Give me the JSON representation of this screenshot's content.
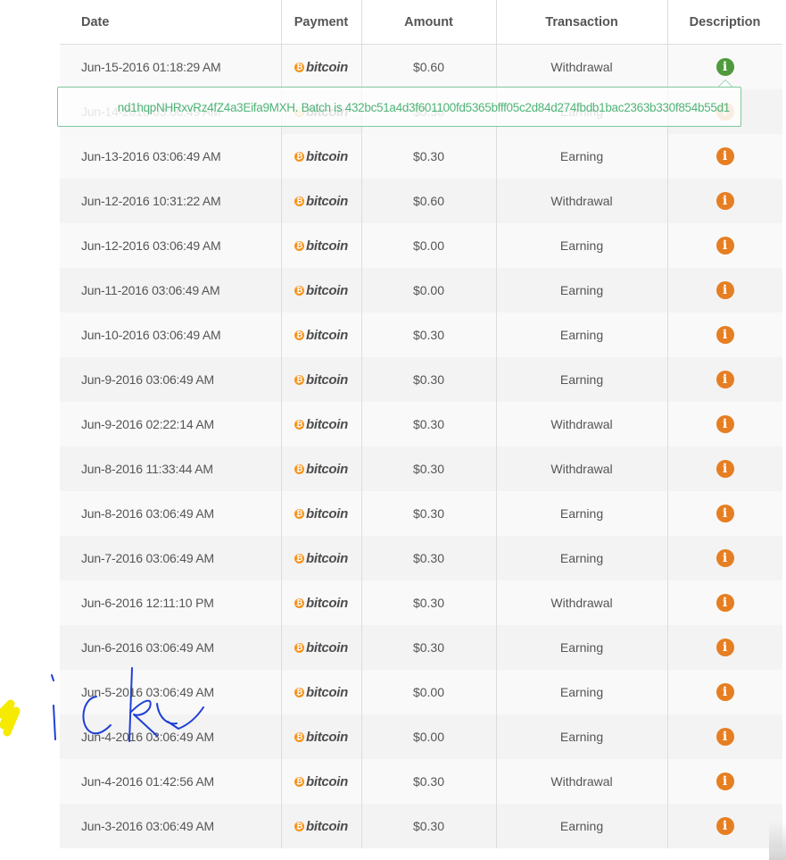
{
  "headers": {
    "date": "Date",
    "payment": "Payment",
    "amount": "Amount",
    "transaction": "Transaction",
    "description": "Description"
  },
  "payment_label": "bitcoin",
  "info_glyph": "i",
  "tooltip": {
    "text": "nd1hqpNHRxvRz4fZ4a3Eifa9MXH. Batch is 432bc51a4d3f601100fd5365bfff05c2d84d274fbdb1bac2363b330f854b55d1"
  },
  "colors": {
    "info_icon": "#e67e22",
    "info_icon_active": "#4f9a3d",
    "bitcoin_orange": "#f7931a",
    "tooltip_text": "#4fb477",
    "scribble_blue": "#1f3fd6",
    "scribble_yellow": "#f5ea00"
  },
  "icons": {
    "info": "info-circle-icon",
    "bitcoin": "bitcoin-logo-icon"
  },
  "rows": [
    {
      "date": "Jun-15-2016 01:18:29 AM",
      "amount": "$0.60",
      "transaction": "Withdrawal"
    },
    {
      "date": "Jun-14-2016 03:06:49 AM",
      "amount": "$0.30",
      "transaction": "Earning"
    },
    {
      "date": "Jun-13-2016 03:06:49 AM",
      "amount": "$0.30",
      "transaction": "Earning"
    },
    {
      "date": "Jun-12-2016 10:31:22 AM",
      "amount": "$0.60",
      "transaction": "Withdrawal"
    },
    {
      "date": "Jun-12-2016 03:06:49 AM",
      "amount": "$0.00",
      "transaction": "Earning"
    },
    {
      "date": "Jun-11-2016 03:06:49 AM",
      "amount": "$0.00",
      "transaction": "Earning"
    },
    {
      "date": "Jun-10-2016 03:06:49 AM",
      "amount": "$0.30",
      "transaction": "Earning"
    },
    {
      "date": "Jun-9-2016 03:06:49 AM",
      "amount": "$0.30",
      "transaction": "Earning"
    },
    {
      "date": "Jun-9-2016 02:22:14 AM",
      "amount": "$0.30",
      "transaction": "Withdrawal"
    },
    {
      "date": "Jun-8-2016 11:33:44 AM",
      "amount": "$0.30",
      "transaction": "Withdrawal"
    },
    {
      "date": "Jun-8-2016 03:06:49 AM",
      "amount": "$0.30",
      "transaction": "Earning"
    },
    {
      "date": "Jun-7-2016 03:06:49 AM",
      "amount": "$0.30",
      "transaction": "Earning"
    },
    {
      "date": "Jun-6-2016 12:11:10 PM",
      "amount": "$0.30",
      "transaction": "Withdrawal"
    },
    {
      "date": "Jun-6-2016 03:06:49 AM",
      "amount": "$0.30",
      "transaction": "Earning"
    },
    {
      "date": "Jun-5-2016 03:06:49 AM",
      "amount": "$0.00",
      "transaction": "Earning"
    },
    {
      "date": "Jun-4-2016 03:06:49 AM",
      "amount": "$0.00",
      "transaction": "Earning"
    },
    {
      "date": "Jun-4-2016 01:42:56 AM",
      "amount": "$0.30",
      "transaction": "Withdrawal"
    },
    {
      "date": "Jun-3-2016 03:06:49 AM",
      "amount": "$0.30",
      "transaction": "Earning"
    }
  ]
}
